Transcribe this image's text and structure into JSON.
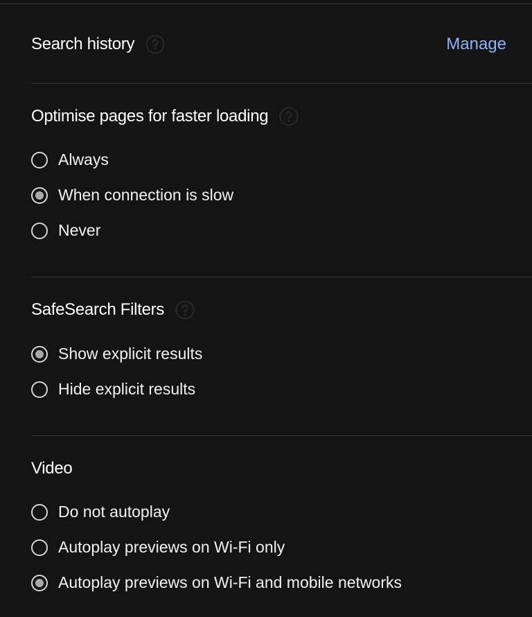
{
  "search_history": {
    "title": "Search history",
    "action_label": "Manage"
  },
  "optimise_pages": {
    "title": "Optimise pages for faster loading",
    "options": [
      {
        "label": "Always",
        "checked": false
      },
      {
        "label": "When connection is slow",
        "checked": true
      },
      {
        "label": "Never",
        "checked": false
      }
    ]
  },
  "safesearch": {
    "title": "SafeSearch Filters",
    "options": [
      {
        "label": "Show explicit results",
        "checked": true
      },
      {
        "label": "Hide explicit results",
        "checked": false
      }
    ]
  },
  "video": {
    "title": "Video",
    "options": [
      {
        "label": "Do not autoplay",
        "checked": false
      },
      {
        "label": "Autoplay previews on Wi-Fi only",
        "checked": false
      },
      {
        "label": "Autoplay previews on Wi-Fi and mobile networks",
        "checked": true
      }
    ]
  },
  "icons": {
    "help": "help-circle-icon",
    "radio_unselected": "radio-unselected-icon",
    "radio_selected": "radio-selected-icon"
  },
  "colors": {
    "background": "#141414",
    "divider": "#3a3a3a",
    "link": "#8ab4f8",
    "radio_border": "#d6d6d6",
    "radio_fill": "#a9a9a9",
    "help_icon": "#2a2a2a"
  }
}
